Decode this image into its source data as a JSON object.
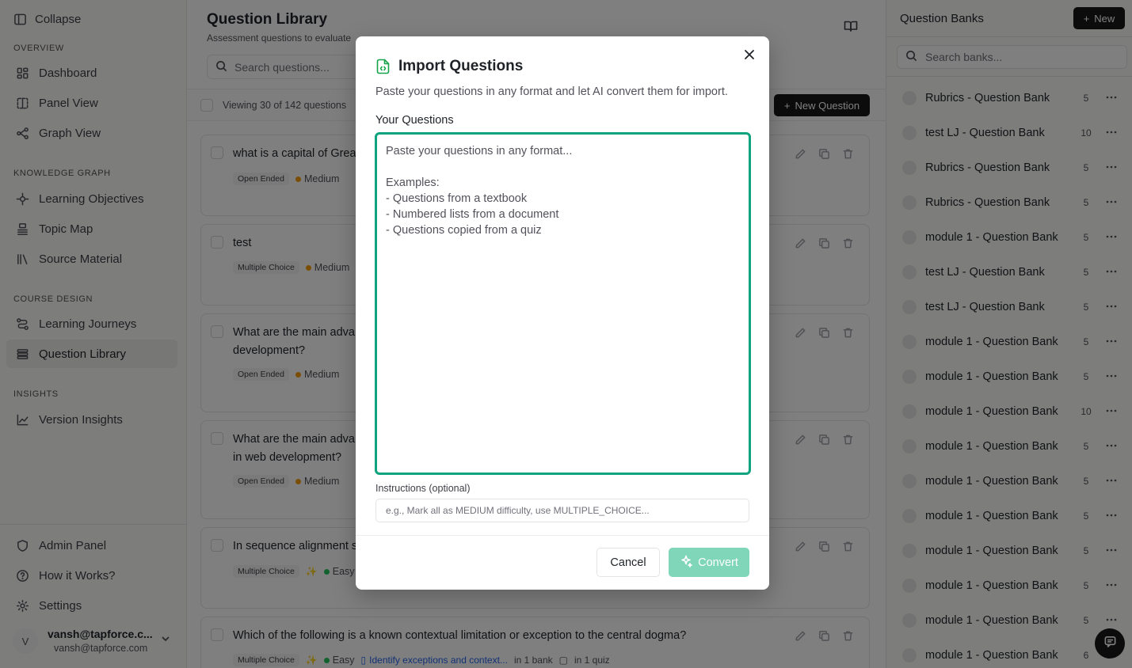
{
  "sidebar": {
    "collapse_label": "Collapse",
    "sections": {
      "overview": "OVERVIEW",
      "knowledge_graph": "KNOWLEDGE GRAPH",
      "course_design": "COURSE DESIGN",
      "insights": "INSIGHTS"
    },
    "items": {
      "dashboard": "Dashboard",
      "panel_view": "Panel View",
      "graph_view": "Graph View",
      "learning_objectives": "Learning Objectives",
      "topic_map": "Topic Map",
      "source_material": "Source Material",
      "learning_journeys": "Learning Journeys",
      "question_library": "Question Library",
      "version_insights": "Version Insights",
      "admin_panel": "Admin Panel",
      "how_it_works": "How it Works?",
      "settings": "Settings"
    },
    "user": {
      "initial": "V",
      "name": "vansh@tapforce.c...",
      "email": "vansh@tapforce.com"
    }
  },
  "main": {
    "title": "Question Library",
    "subtitle": "Assessment questions to evaluate",
    "search_placeholder": "Search questions...",
    "viewing_text": "Viewing 30 of 142 questions",
    "new_question_label": "New Question",
    "questions": [
      {
        "text": "what is a capital of Grea",
        "type": "Open Ended",
        "difficulty": "Medium"
      },
      {
        "text": "test",
        "type": "Multiple Choice",
        "difficulty": "Medium"
      },
      {
        "text": "What are the main adva",
        "text2": "development?",
        "type": "Open Ended",
        "difficulty": "Medium"
      },
      {
        "text": "What are the main adva",
        "text2": "in web development?",
        "type": "Open Ended",
        "difficulty": "Medium"
      },
      {
        "text": "In sequence alignment s",
        "type": "Multiple Choice",
        "difficulty": "Easy"
      },
      {
        "text": "Which of the following is a known contextual limitation or exception to the central dogma?",
        "type": "Multiple Choice",
        "difficulty": "Easy",
        "objective": "Identify exceptions and context...",
        "bank_info": "in 1 bank",
        "quiz_info": "in 1 quiz"
      }
    ]
  },
  "right_panel": {
    "title": "Question Banks",
    "new_label": "New",
    "search_placeholder": "Search banks...",
    "banks": [
      {
        "name": "Rubrics - Question Bank",
        "count": "5"
      },
      {
        "name": "test LJ - Question Bank",
        "count": "10"
      },
      {
        "name": "Rubrics - Question Bank",
        "count": "5"
      },
      {
        "name": "Rubrics - Question Bank",
        "count": "5"
      },
      {
        "name": "module 1 - Question Bank",
        "count": "5"
      },
      {
        "name": "test LJ - Question Bank",
        "count": "5"
      },
      {
        "name": "test LJ - Question Bank",
        "count": "5"
      },
      {
        "name": "module 1 - Question Bank",
        "count": "5"
      },
      {
        "name": "module 1 - Question Bank",
        "count": "5"
      },
      {
        "name": "module 1 - Question Bank",
        "count": "10"
      },
      {
        "name": "module 1 - Question Bank",
        "count": "5"
      },
      {
        "name": "module 1 - Question Bank",
        "count": "5"
      },
      {
        "name": "module 1 - Question Bank",
        "count": "5"
      },
      {
        "name": "module 1 - Question Bank",
        "count": "5"
      },
      {
        "name": "module 1 - Question Bank",
        "count": "5"
      },
      {
        "name": "module 1 - Question Bank",
        "count": "5"
      },
      {
        "name": "module 1 - Question Bank",
        "count": "6"
      }
    ]
  },
  "modal": {
    "title": "Import Questions",
    "description": "Paste your questions in any format and let AI convert them for import.",
    "questions_label": "Your Questions",
    "questions_placeholder": "Paste your questions in any format...\n\nExamples:\n- Questions from a textbook\n- Numbered lists from a document\n- Questions copied from a quiz",
    "questions_value": "",
    "instructions_label": "Instructions (optional)",
    "instructions_placeholder": "e.g., Mark all as MEDIUM difficulty, use MULTIPLE_CHOICE...",
    "instructions_value": "",
    "cancel_label": "Cancel",
    "convert_label": "Convert"
  },
  "colors": {
    "accent": "#10a37f",
    "convert_disabled": "#7fd6b9",
    "medium": "#f59e0b",
    "easy": "#22c55e",
    "link": "#2563eb",
    "primary_button": "#18181b"
  }
}
